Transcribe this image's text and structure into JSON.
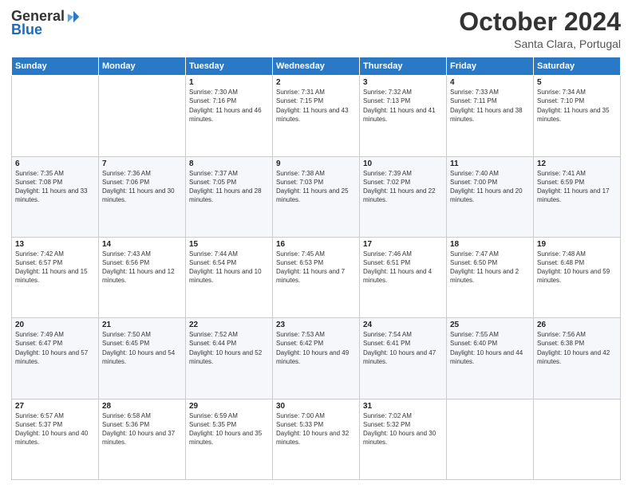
{
  "header": {
    "logo_general": "General",
    "logo_blue": "Blue",
    "month": "October 2024",
    "location": "Santa Clara, Portugal"
  },
  "days_of_week": [
    "Sunday",
    "Monday",
    "Tuesday",
    "Wednesday",
    "Thursday",
    "Friday",
    "Saturday"
  ],
  "weeks": [
    [
      {
        "day": "",
        "info": ""
      },
      {
        "day": "",
        "info": ""
      },
      {
        "day": "1",
        "info": "Sunrise: 7:30 AM\nSunset: 7:16 PM\nDaylight: 11 hours and 46 minutes."
      },
      {
        "day": "2",
        "info": "Sunrise: 7:31 AM\nSunset: 7:15 PM\nDaylight: 11 hours and 43 minutes."
      },
      {
        "day": "3",
        "info": "Sunrise: 7:32 AM\nSunset: 7:13 PM\nDaylight: 11 hours and 41 minutes."
      },
      {
        "day": "4",
        "info": "Sunrise: 7:33 AM\nSunset: 7:11 PM\nDaylight: 11 hours and 38 minutes."
      },
      {
        "day": "5",
        "info": "Sunrise: 7:34 AM\nSunset: 7:10 PM\nDaylight: 11 hours and 35 minutes."
      }
    ],
    [
      {
        "day": "6",
        "info": "Sunrise: 7:35 AM\nSunset: 7:08 PM\nDaylight: 11 hours and 33 minutes."
      },
      {
        "day": "7",
        "info": "Sunrise: 7:36 AM\nSunset: 7:06 PM\nDaylight: 11 hours and 30 minutes."
      },
      {
        "day": "8",
        "info": "Sunrise: 7:37 AM\nSunset: 7:05 PM\nDaylight: 11 hours and 28 minutes."
      },
      {
        "day": "9",
        "info": "Sunrise: 7:38 AM\nSunset: 7:03 PM\nDaylight: 11 hours and 25 minutes."
      },
      {
        "day": "10",
        "info": "Sunrise: 7:39 AM\nSunset: 7:02 PM\nDaylight: 11 hours and 22 minutes."
      },
      {
        "day": "11",
        "info": "Sunrise: 7:40 AM\nSunset: 7:00 PM\nDaylight: 11 hours and 20 minutes."
      },
      {
        "day": "12",
        "info": "Sunrise: 7:41 AM\nSunset: 6:59 PM\nDaylight: 11 hours and 17 minutes."
      }
    ],
    [
      {
        "day": "13",
        "info": "Sunrise: 7:42 AM\nSunset: 6:57 PM\nDaylight: 11 hours and 15 minutes."
      },
      {
        "day": "14",
        "info": "Sunrise: 7:43 AM\nSunset: 6:56 PM\nDaylight: 11 hours and 12 minutes."
      },
      {
        "day": "15",
        "info": "Sunrise: 7:44 AM\nSunset: 6:54 PM\nDaylight: 11 hours and 10 minutes."
      },
      {
        "day": "16",
        "info": "Sunrise: 7:45 AM\nSunset: 6:53 PM\nDaylight: 11 hours and 7 minutes."
      },
      {
        "day": "17",
        "info": "Sunrise: 7:46 AM\nSunset: 6:51 PM\nDaylight: 11 hours and 4 minutes."
      },
      {
        "day": "18",
        "info": "Sunrise: 7:47 AM\nSunset: 6:50 PM\nDaylight: 11 hours and 2 minutes."
      },
      {
        "day": "19",
        "info": "Sunrise: 7:48 AM\nSunset: 6:48 PM\nDaylight: 10 hours and 59 minutes."
      }
    ],
    [
      {
        "day": "20",
        "info": "Sunrise: 7:49 AM\nSunset: 6:47 PM\nDaylight: 10 hours and 57 minutes."
      },
      {
        "day": "21",
        "info": "Sunrise: 7:50 AM\nSunset: 6:45 PM\nDaylight: 10 hours and 54 minutes."
      },
      {
        "day": "22",
        "info": "Sunrise: 7:52 AM\nSunset: 6:44 PM\nDaylight: 10 hours and 52 minutes."
      },
      {
        "day": "23",
        "info": "Sunrise: 7:53 AM\nSunset: 6:42 PM\nDaylight: 10 hours and 49 minutes."
      },
      {
        "day": "24",
        "info": "Sunrise: 7:54 AM\nSunset: 6:41 PM\nDaylight: 10 hours and 47 minutes."
      },
      {
        "day": "25",
        "info": "Sunrise: 7:55 AM\nSunset: 6:40 PM\nDaylight: 10 hours and 44 minutes."
      },
      {
        "day": "26",
        "info": "Sunrise: 7:56 AM\nSunset: 6:38 PM\nDaylight: 10 hours and 42 minutes."
      }
    ],
    [
      {
        "day": "27",
        "info": "Sunrise: 6:57 AM\nSunset: 5:37 PM\nDaylight: 10 hours and 40 minutes."
      },
      {
        "day": "28",
        "info": "Sunrise: 6:58 AM\nSunset: 5:36 PM\nDaylight: 10 hours and 37 minutes."
      },
      {
        "day": "29",
        "info": "Sunrise: 6:59 AM\nSunset: 5:35 PM\nDaylight: 10 hours and 35 minutes."
      },
      {
        "day": "30",
        "info": "Sunrise: 7:00 AM\nSunset: 5:33 PM\nDaylight: 10 hours and 32 minutes."
      },
      {
        "day": "31",
        "info": "Sunrise: 7:02 AM\nSunset: 5:32 PM\nDaylight: 10 hours and 30 minutes."
      },
      {
        "day": "",
        "info": ""
      },
      {
        "day": "",
        "info": ""
      }
    ]
  ]
}
